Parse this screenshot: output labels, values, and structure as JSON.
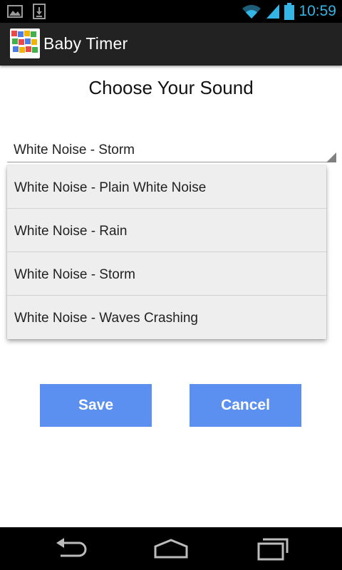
{
  "status_bar": {
    "time": "10:59",
    "icons": [
      "gallery-notification-icon",
      "download-notification-icon",
      "wifi-icon",
      "signal-icon",
      "battery-icon"
    ]
  },
  "action_bar": {
    "title": "Baby Timer",
    "app_icon": "baby-timer-logo-icon"
  },
  "main": {
    "heading": "Choose Your Sound",
    "spinner": {
      "selected": "White Noise - Storm",
      "options": [
        "White Noise - Plain White Noise",
        "White Noise - Rain",
        "White Noise - Storm",
        "White Noise - Waves Crashing"
      ]
    },
    "buttons": {
      "save_label": "Save",
      "cancel_label": "Cancel"
    }
  },
  "colors": {
    "status_accent": "#33b5e5",
    "action_bar_bg": "#222222",
    "button_bg": "#5b8ff0",
    "dropdown_bg": "#eeeeee"
  },
  "nav_bar": {
    "icons": [
      "back-icon",
      "home-icon",
      "recent-apps-icon"
    ]
  }
}
